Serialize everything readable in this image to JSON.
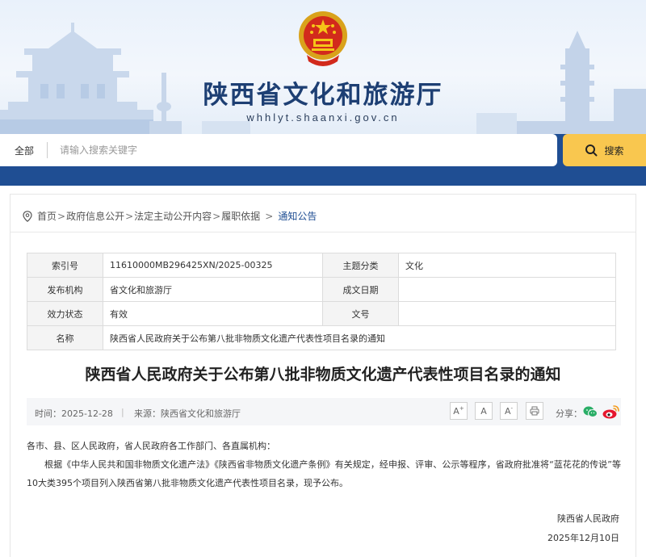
{
  "site": {
    "title": "陕西省文化和旅游厅",
    "domain": "whhlyt.shaanxi.gov.cn"
  },
  "search": {
    "scope": "全部",
    "placeholder": "请输入搜索关键字",
    "button_label": "搜索"
  },
  "breadcrumb": {
    "items": [
      "首页",
      "政府信息公开",
      "法定主动公开内容",
      "履职依据"
    ],
    "current": "通知公告"
  },
  "meta": {
    "index_label": "索引号",
    "index_value": "11610000MB296425XN/2025-00325",
    "topic_label": "主题分类",
    "topic_value": "文化",
    "publisher_label": "发布机构",
    "publisher_value": "省文化和旅游厅",
    "date_label": "成文日期",
    "date_value": "",
    "status_label": "效力状态",
    "status_value": "有效",
    "doc_no_label": "文号",
    "doc_no_value": "",
    "name_label": "名称",
    "name_value": "陕西省人民政府关于公布第八批非物质文化遗产代表性项目名录的通知"
  },
  "article": {
    "title": "陕西省人民政府关于公布第八批非物质文化遗产代表性项目名录的通知",
    "time": "时间：2025-12-28",
    "source": "来源：陕西省文化和旅游厅",
    "font_increase": "A",
    "font_reset": "A",
    "font_decrease": "A",
    "share_label": "分享：",
    "salutation": "各市、县、区人民政府，省人民政府各工作部门、各直属机构：",
    "paragraph": "根据《中华人民共和国非物质文化遗产法》《陕西省非物质文化遗产条例》有关规定，经申报、评审、公示等程序，省政府批准将“蓝花花的传说”等10大类395个项目列入陕西省第八批非物质文化遗产代表性项目名录，现予公布。",
    "signature": "陕西省人民政府",
    "sign_date": "2025年12月10日"
  },
  "colors": {
    "brand_blue": "#1f4e93",
    "search_button": "#f9c74f",
    "wechat_green": "#2aae67",
    "weibo_red": "#e6162d"
  },
  "icons": {
    "breadcrumb": "location-pin-icon",
    "search": "magnifier-icon",
    "print": "print-icon",
    "wechat": "wechat-icon",
    "weibo": "weibo-icon",
    "emblem": "national-emblem"
  }
}
